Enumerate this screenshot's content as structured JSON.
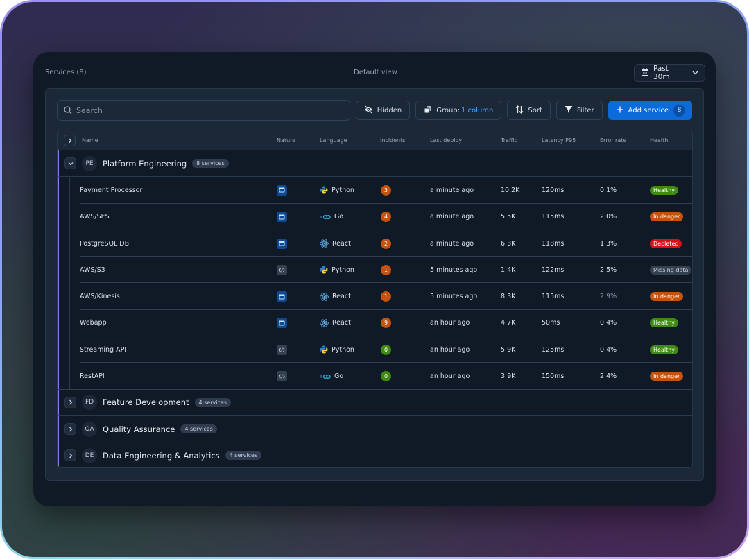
{
  "header": {
    "title": "Services (8)",
    "view_name": "Default view",
    "time_range": "Past 30m"
  },
  "toolbar": {
    "search_placeholder": "Search",
    "search_value": "",
    "hidden_label": "Hidden",
    "group_label": "Group:",
    "group_value": "1 column",
    "sort_label": "Sort",
    "filter_label": "Filter",
    "add_label": "Add service",
    "add_count": "8"
  },
  "columns": {
    "name": "Name",
    "nature": "Nature",
    "language": "Language",
    "incidents": "Incidents",
    "last_deploy": "Last deploy",
    "traffic": "Traffic",
    "latency": "Latency P95",
    "error_rate": "Error rate",
    "health": "Health"
  },
  "colors": {
    "accent": "#0b6bd9",
    "group_bar": "#8a7df0",
    "healthy": "#3f8a12",
    "in_danger": "#c4530f",
    "depleted": "#d90f16",
    "missing": "#33404f",
    "incident_orange": "#c4530f",
    "incident_green": "#3f8a12"
  },
  "groups": [
    {
      "initials": "PE",
      "name": "Platform Engineering",
      "count": "8 services",
      "expanded": true,
      "services": [
        {
          "name": "Payment Processor",
          "nature": "web",
          "language": "Python",
          "incidents": "3",
          "incident_level": "warn",
          "last_deploy": "a minute ago",
          "traffic": "10.2K",
          "latency": "120ms",
          "error_rate": "0.1%",
          "health": "Healthy",
          "health_key": "healthy"
        },
        {
          "name": "AWS/SES",
          "nature": "web",
          "language": "Go",
          "incidents": "4",
          "incident_level": "warn",
          "last_deploy": "a minute ago",
          "traffic": "5.5K",
          "latency": "115ms",
          "error_rate": "2.0%",
          "health": "In danger",
          "health_key": "in_danger"
        },
        {
          "name": "PostgreSQL DB",
          "nature": "web",
          "language": "React",
          "incidents": "2",
          "incident_level": "warn",
          "last_deploy": "a minute ago",
          "traffic": "6.3K",
          "latency": "118ms",
          "error_rate": "1.3%",
          "health": "Depleted",
          "health_key": "depleted"
        },
        {
          "name": "AWS/S3",
          "nature": "api",
          "language": "Python",
          "incidents": "1",
          "incident_level": "warn",
          "last_deploy": "5 minutes ago",
          "traffic": "1.4K",
          "latency": "122ms",
          "error_rate": "2.5%",
          "health": "Missing data",
          "health_key": "missing"
        },
        {
          "name": "AWS/Kinesis",
          "nature": "web",
          "language": "React",
          "incidents": "1",
          "incident_level": "warn",
          "last_deploy": "5 minutes ago",
          "traffic": "8.3K",
          "latency": "115ms",
          "error_rate": "2.9%",
          "health": "In danger",
          "health_key": "in_danger"
        },
        {
          "name": "Webapp",
          "nature": "web",
          "language": "React",
          "incidents": "9",
          "incident_level": "warn",
          "last_deploy": "an hour ago",
          "traffic": "4.7K",
          "latency": "50ms",
          "error_rate": "0.4%",
          "health": "Healthy",
          "health_key": "healthy"
        },
        {
          "name": "Streaming API",
          "nature": "api",
          "language": "Python",
          "incidents": "0",
          "incident_level": "ok",
          "last_deploy": "an hour ago",
          "traffic": "5.9K",
          "latency": "125ms",
          "error_rate": "0.4%",
          "health": "Healthy",
          "health_key": "healthy"
        },
        {
          "name": "RestAPI",
          "nature": "api",
          "language": "Go",
          "incidents": "0",
          "incident_level": "ok",
          "last_deploy": "an hour ago",
          "traffic": "3.9K",
          "latency": "150ms",
          "error_rate": "2.4%",
          "health": "In danger",
          "health_key": "in_danger"
        }
      ]
    },
    {
      "initials": "FD",
      "name": "Feature Development",
      "count": "4 services",
      "expanded": false,
      "services": []
    },
    {
      "initials": "QA",
      "name": "Quality Assurance",
      "count": "4 services",
      "expanded": false,
      "services": []
    },
    {
      "initials": "DE",
      "name": "Data Engineering & Analytics",
      "count": "4 services",
      "expanded": false,
      "services": []
    }
  ]
}
